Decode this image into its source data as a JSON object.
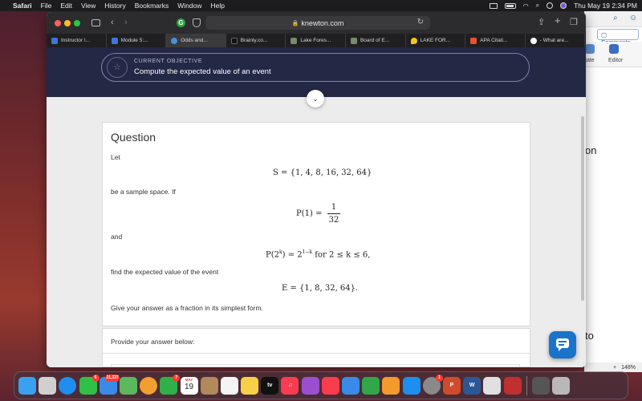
{
  "menubar": {
    "app_name": "Safari",
    "items": [
      "File",
      "Edit",
      "View",
      "History",
      "Bookmarks",
      "Window",
      "Help"
    ],
    "clock": "Thu May 19  2:34 PM"
  },
  "safari": {
    "url": "knewton.com",
    "tabs": [
      {
        "label": "Instructor I...",
        "icon_color": "#3d78d8"
      },
      {
        "label": "Module 5:...",
        "icon_color": "#3d78d8"
      },
      {
        "label": "Odds and...",
        "icon_color": "#4a90d9"
      },
      {
        "label": "Brainly.co...",
        "icon_color": "#111111"
      },
      {
        "label": "Lake Fores...",
        "icon_color": "#7a8a6a"
      },
      {
        "label": "Board of E...",
        "icon_color": "#7a8a6a"
      },
      {
        "label": "LAKE FOR...",
        "icon_color": "#f5c518"
      },
      {
        "label": "APA Citati...",
        "icon_color": "#e8522e"
      },
      {
        "label": "- What are...",
        "icon_color": "#ffffff"
      }
    ]
  },
  "objective": {
    "label": "CURRENT OBJECTIVE",
    "text": "Compute the expected value of an event"
  },
  "question": {
    "title": "Question",
    "let": "Let",
    "sample_space": "S = {1, 4, 8, 16, 32, 64}",
    "be_sample_space": "be a sample space. If",
    "p1_left": "P(1) =",
    "p1_num": "1",
    "p1_den": "32",
    "and": "and",
    "pk_a": "P(2",
    "pk_k": "k",
    "pk_b": ") = 2",
    "pk_exp": "1−k",
    "pk_c": " for 2 ≤ k ≤ 6,",
    "find": "find the expected value of the event",
    "event": "E = {1, 8, 32, 64}.",
    "instruction": "Give your answer as a fraction in its simplest form."
  },
  "answer": {
    "prompt": "Provide your answer below:"
  },
  "word": {
    "comments": "Comments",
    "tool1": "tate",
    "tool2": "Editor",
    "text1": "on",
    "text2": "to",
    "zoom": "148%"
  },
  "dock": {
    "apps": [
      {
        "name": "finder",
        "color": "#3aa0f0"
      },
      {
        "name": "launchpad",
        "color": "#d0d0d0"
      },
      {
        "name": "safari",
        "color": "#1e8ef0"
      },
      {
        "name": "messages",
        "color": "#30c048",
        "badge": "6"
      },
      {
        "name": "mail",
        "color": "#3a8ae8",
        "badge": "21,337"
      },
      {
        "name": "maps",
        "color": "#5cb85c"
      },
      {
        "name": "photos",
        "color": "#f0a030"
      },
      {
        "name": "facetime",
        "color": "#30b048",
        "badge": "7"
      },
      {
        "name": "calendar",
        "color": "#ffffff",
        "text": "19",
        "month": "MAY"
      },
      {
        "name": "contacts",
        "color": "#b08a5a"
      },
      {
        "name": "reminders",
        "color": "#f4f4f4"
      },
      {
        "name": "notes",
        "color": "#f7d04a"
      },
      {
        "name": "tv",
        "color": "#111111",
        "text": "tv"
      },
      {
        "name": "music",
        "color": "#fa3c50"
      },
      {
        "name": "podcasts",
        "color": "#9b4fd0"
      },
      {
        "name": "news",
        "color": "#fa3c4c"
      },
      {
        "name": "keynote",
        "color": "#3a8ae8"
      },
      {
        "name": "numbers",
        "color": "#30a848"
      },
      {
        "name": "pages",
        "color": "#f29a2e"
      },
      {
        "name": "app-store",
        "color": "#1e8ef0"
      },
      {
        "name": "system-preferences",
        "color": "#8a8a8a",
        "badge": "1"
      },
      {
        "name": "powerpoint",
        "color": "#d04a2c",
        "text": "P"
      },
      {
        "name": "word",
        "color": "#2b5797",
        "text": "W"
      },
      {
        "name": "preview",
        "color": "#e0e0e0"
      },
      {
        "name": "photo-booth",
        "color": "#c03030"
      },
      {
        "name": "screen-capture",
        "color": "#555555"
      },
      {
        "name": "trash",
        "color": "#b8b8b8"
      }
    ]
  }
}
